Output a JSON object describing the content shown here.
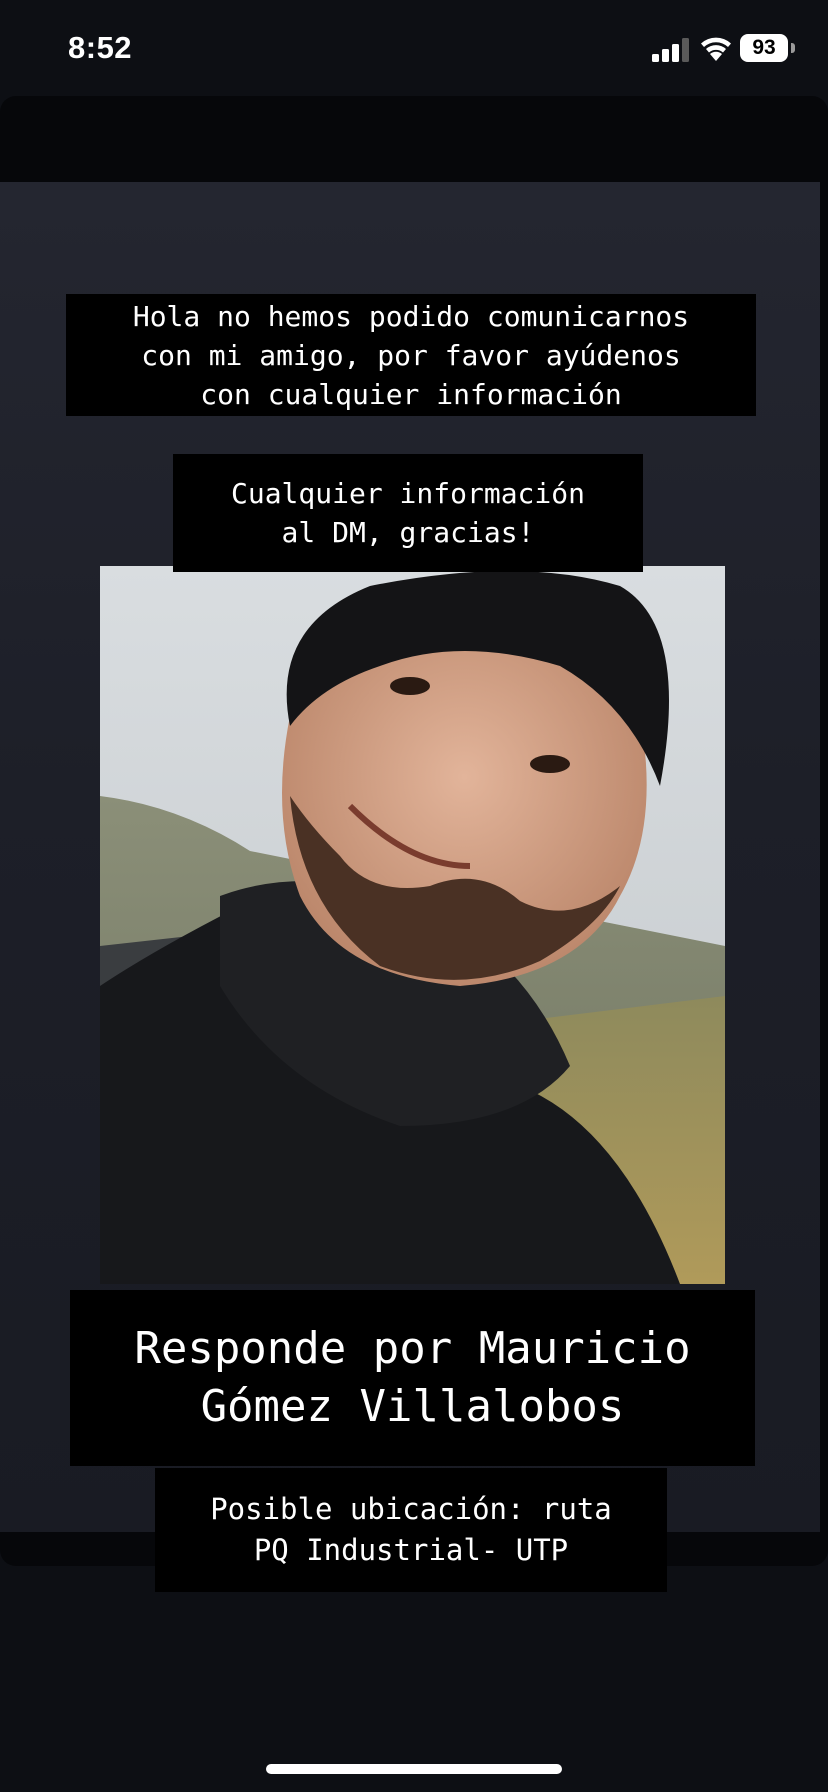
{
  "status_bar": {
    "time": "8:52",
    "battery_level": "93",
    "icons": [
      "signal-icon",
      "wifi-icon",
      "battery-icon"
    ]
  },
  "story": {
    "caption_top": "Hola no hemos podido comunicarnos\ncon mi amigo, por favor ayúdenos\ncon cualquier información",
    "caption_dm": "Cualquier información\nal DM, gracias!",
    "caption_name": "Responde por Mauricio\nGómez Villalobos",
    "caption_location": "Posible ubicación: ruta\nPQ Industrial- UTP"
  },
  "colors": {
    "background": "#0d0f14",
    "caption_background": "#000000",
    "caption_text": "#ffffff"
  }
}
